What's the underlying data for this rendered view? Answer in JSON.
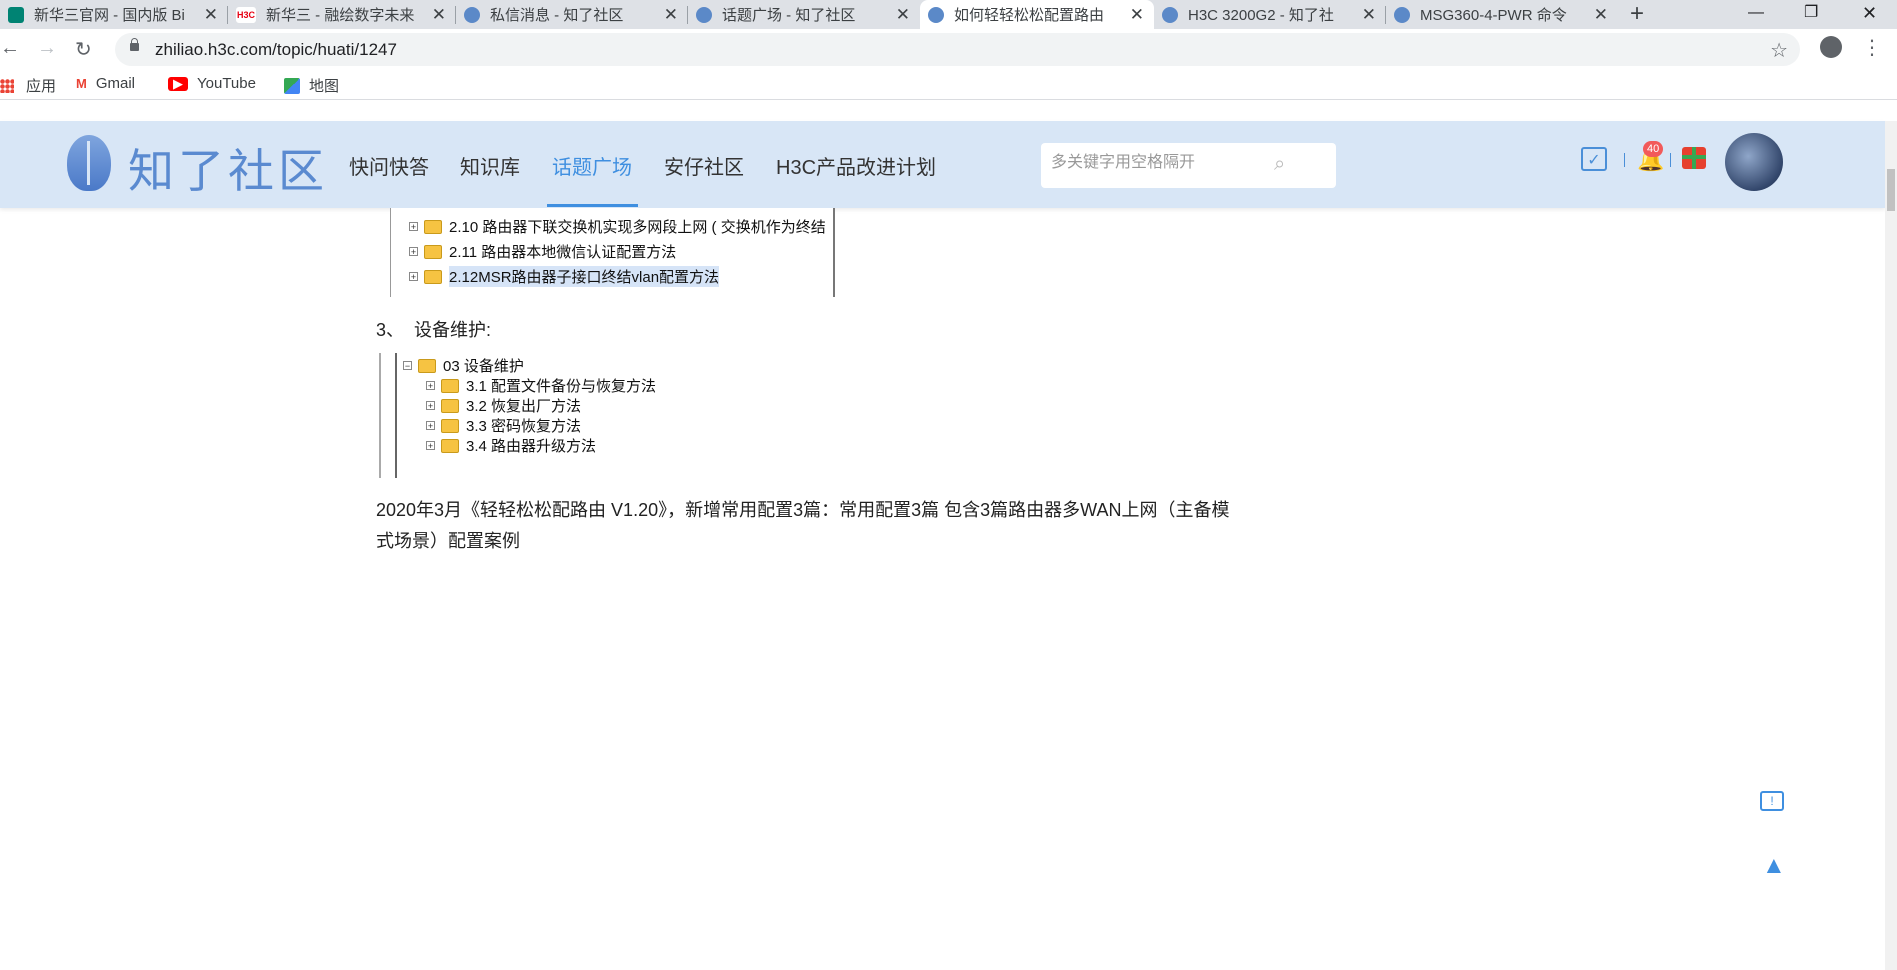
{
  "browser": {
    "tabs": [
      {
        "title": "新华三官网 - 国内版 Bi",
        "favicon": "bing"
      },
      {
        "title": "新华三 - 融绘数字未来",
        "favicon": "h3c"
      },
      {
        "title": "私信消息 - 知了社区",
        "favicon": "zhiliao"
      },
      {
        "title": "话题广场 - 知了社区",
        "favicon": "zhiliao"
      },
      {
        "title": "如何轻轻松松配置路由",
        "favicon": "zhiliao"
      },
      {
        "title": "H3C 3200G2 - 知了社",
        "favicon": "zhiliao"
      },
      {
        "title": "MSG360-4-PWR 命令",
        "favicon": "zhiliao"
      }
    ],
    "h3c_favicon_text": "H3C",
    "url": "zhiliao.h3c.com/topic/huati/1247",
    "bookmarks": [
      {
        "label": "应用",
        "icon": "apps-grid-icon"
      },
      {
        "label": "Gmail",
        "icon": "gmail-icon"
      },
      {
        "label": "YouTube",
        "icon": "youtube-icon"
      },
      {
        "label": "地图",
        "icon": "maps-icon"
      }
    ]
  },
  "site": {
    "logo_text": "知了社区",
    "nav": [
      "快问快答",
      "知识库",
      "话题广场",
      "安仔社区",
      "H3C产品改进计划"
    ],
    "active_nav": "话题广场",
    "search_placeholder": "多关键字用空格隔开",
    "notification_count": "40"
  },
  "content": {
    "tree1": [
      {
        "label": "2.10 路由器下联交换机实现多网段上网 ( 交换机作为终结",
        "selected": false
      },
      {
        "label": "2.11 路由器本地微信认证配置方法",
        "selected": false
      },
      {
        "label": "2.12MSR路由器子接口终结vlan配置方法",
        "selected": true
      }
    ],
    "step_number": "3、",
    "step_label": "设备维护:",
    "tree2_root": "03 设备维护",
    "tree2": [
      "3.1 配置文件备份与恢复方法",
      "3.2 恢复出厂方法",
      "3.3 密码恢复方法",
      "3.4 路由器升级方法"
    ],
    "paragraph": "2020年3月《轻轻松松配路由 V1.20》，新增常用配置3篇：常用配置3篇  包含3篇路由器多WAN上网（主备模式场景）配置案例"
  },
  "colors": {
    "header_bg": "#d8e6f6",
    "accent": "#3f8fe0",
    "logo": "#5a8ad0"
  }
}
